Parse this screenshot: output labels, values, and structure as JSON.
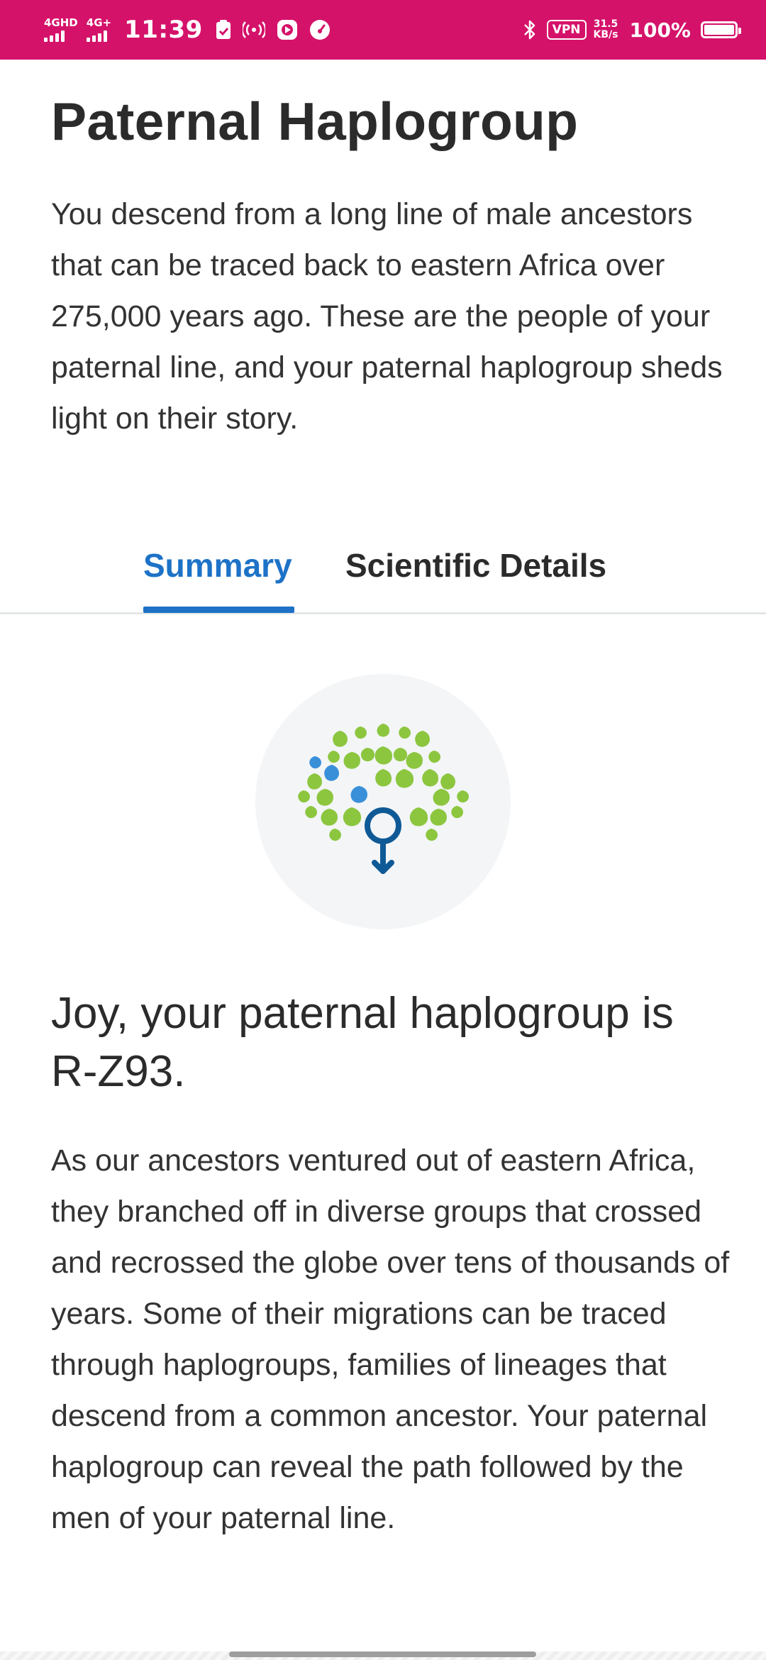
{
  "status_bar": {
    "net1": "4GHD",
    "net2": "4G+",
    "time": "11:39",
    "vpn": "VPN",
    "speed_value": "31.5",
    "speed_unit": "KB/s",
    "battery": "100%",
    "battery_level": 1.0
  },
  "page": {
    "title": "Paternal Haplogroup",
    "intro": "You descend from a long line of male ancestors that can be traced back to eastern Africa over 275,000 years ago. These are the people of your paternal line, and your paternal haplogroup sheds light on their story."
  },
  "tabs": [
    {
      "label": "Summary",
      "active": true
    },
    {
      "label": "Scientific Details",
      "active": false
    }
  ],
  "summary": {
    "headline": "Joy, your paternal haplogroup is R-Z93.",
    "body": "As our ancestors ventured out of eastern Africa, they branched off in diverse groups that crossed and recrossed the globe over tens of thousands of years. Some of their migrations can be traced through haplogroups, families of lineages that descend from a common ancestor. Your paternal haplogroup can reveal the path followed by the men of your paternal line."
  },
  "icons": {
    "emblem": "paternal-tree-icon"
  },
  "colors": {
    "status_bar": "#d5126a",
    "accent": "#1d72c7",
    "leaf_green": "#8cc63f",
    "leaf_blue": "#3a8fd9",
    "male_symbol": "#0f5a96"
  }
}
